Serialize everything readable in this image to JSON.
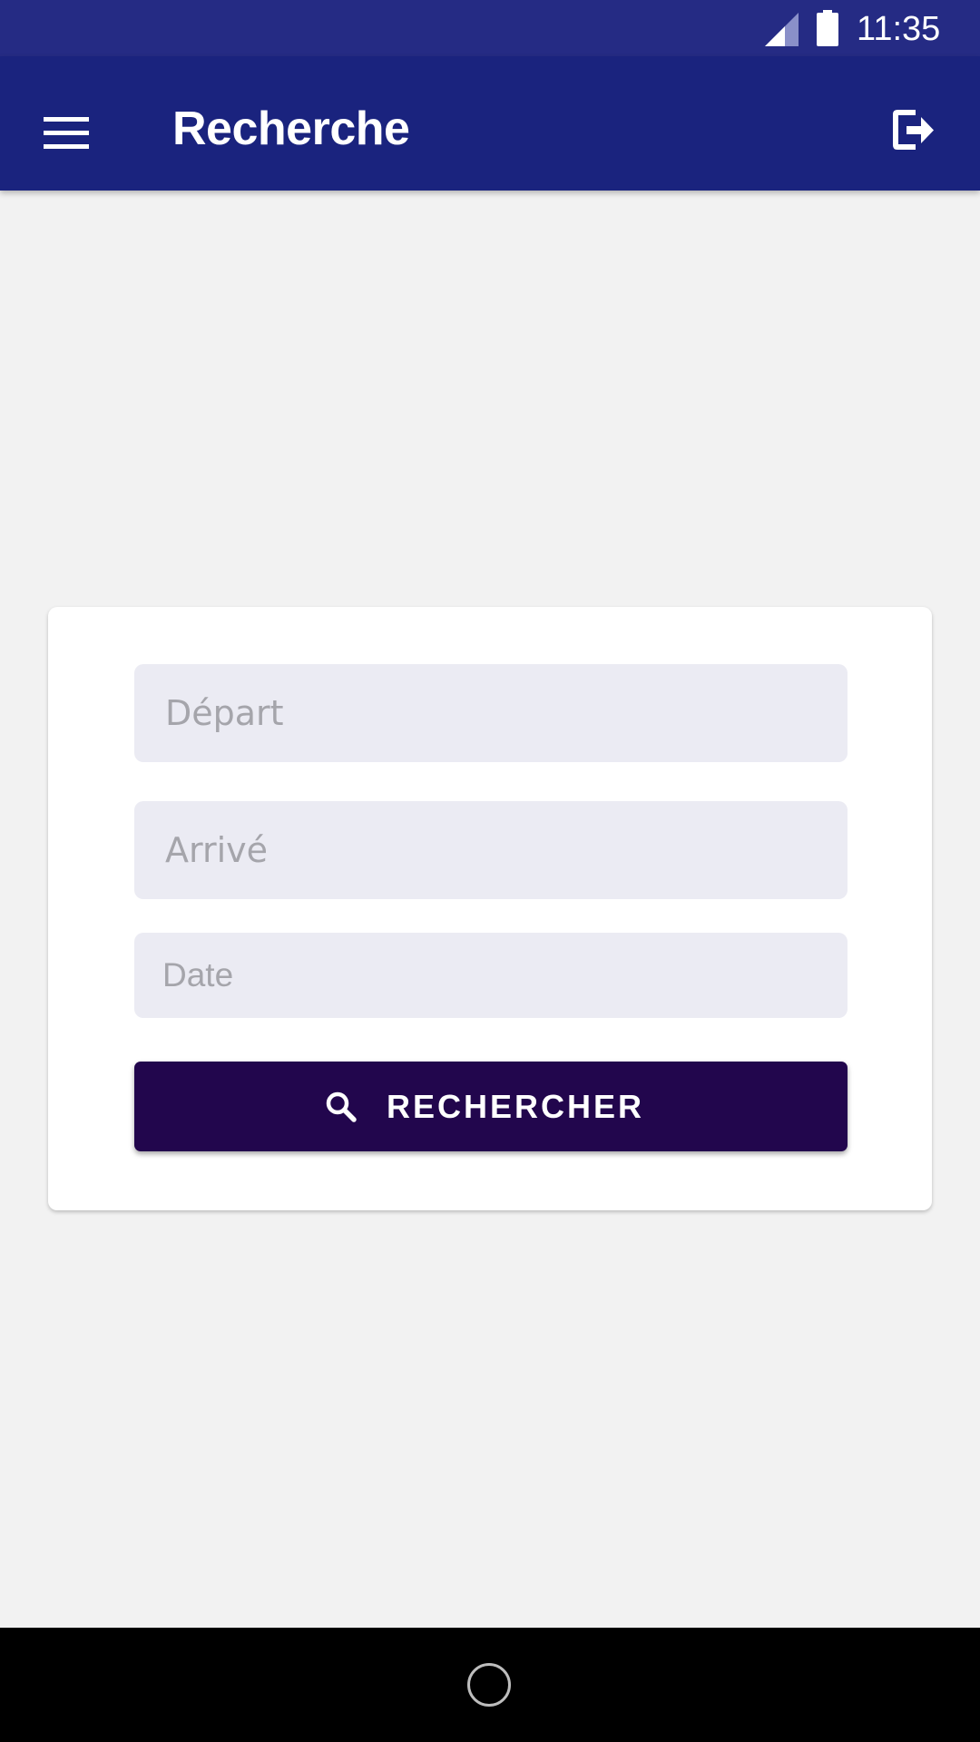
{
  "status_bar": {
    "time": "11:35",
    "icons": [
      "signal-icon",
      "battery-icon"
    ]
  },
  "app_bar": {
    "title": "Recherche",
    "menu_icon": "hamburger-menu-icon",
    "logout_icon": "logout-icon"
  },
  "form": {
    "depart_placeholder": "Départ",
    "arrive_placeholder": "Arrivé",
    "date_placeholder": "Date",
    "search_button_label": "RECHERCHER",
    "search_icon": "search-icon"
  },
  "nav_bar": {
    "home_icon": "home-circle-icon"
  },
  "colors": {
    "status_bar": "#252b84",
    "app_bar": "#1a237e",
    "background": "#f2f2f2",
    "field_background": "#ebebf3",
    "button": "#22064d",
    "nav_bar": "#000000"
  }
}
